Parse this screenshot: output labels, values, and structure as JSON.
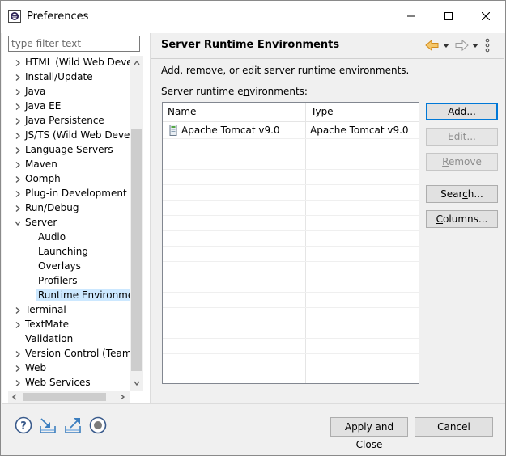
{
  "window": {
    "title": "Preferences"
  },
  "filter": {
    "placeholder": "type filter text"
  },
  "tree": {
    "items": [
      {
        "label": "HTML (Wild Web Develc",
        "expandable": true,
        "level": 0
      },
      {
        "label": "Install/Update",
        "expandable": true,
        "level": 0
      },
      {
        "label": "Java",
        "expandable": true,
        "level": 0
      },
      {
        "label": "Java EE",
        "expandable": true,
        "level": 0
      },
      {
        "label": "Java Persistence",
        "expandable": true,
        "level": 0
      },
      {
        "label": "JS/TS (Wild Web Develc",
        "expandable": true,
        "level": 0
      },
      {
        "label": "Language Servers",
        "expandable": true,
        "level": 0
      },
      {
        "label": "Maven",
        "expandable": true,
        "level": 0
      },
      {
        "label": "Oomph",
        "expandable": true,
        "level": 0
      },
      {
        "label": "Plug-in Development",
        "expandable": true,
        "level": 0
      },
      {
        "label": "Run/Debug",
        "expandable": true,
        "level": 0
      },
      {
        "label": "Server",
        "expandable": true,
        "expanded": true,
        "level": 0
      },
      {
        "label": "Audio",
        "expandable": false,
        "level": 1
      },
      {
        "label": "Launching",
        "expandable": false,
        "level": 1
      },
      {
        "label": "Overlays",
        "expandable": false,
        "level": 1
      },
      {
        "label": "Profilers",
        "expandable": false,
        "level": 1
      },
      {
        "label": "Runtime Environmen",
        "expandable": false,
        "level": 1,
        "selected": true
      },
      {
        "label": "Terminal",
        "expandable": true,
        "level": 0
      },
      {
        "label": "TextMate",
        "expandable": true,
        "level": 0
      },
      {
        "label": "Validation",
        "expandable": false,
        "level": 0
      },
      {
        "label": "Version Control (Team)",
        "expandable": true,
        "level": 0
      },
      {
        "label": "Web",
        "expandable": true,
        "level": 0
      },
      {
        "label": "Web Services",
        "expandable": true,
        "level": 0
      }
    ]
  },
  "page": {
    "title": "Server Runtime Environments",
    "description": "Add, remove, or edit server runtime environments.",
    "list_label_pre": "Server runtime e",
    "list_label_mnemonic": "n",
    "list_label_post": "vironments:"
  },
  "table": {
    "columns": [
      "Name",
      "Type"
    ],
    "rows": [
      {
        "name": "Apache Tomcat v9.0",
        "type": "Apache Tomcat v9.0"
      }
    ]
  },
  "buttons": {
    "add_mnemonic": "A",
    "add_rest": "dd...",
    "edit_mnemonic": "E",
    "edit_rest": "dit...",
    "remove_mnemonic": "R",
    "remove_rest": "emove",
    "search_pre": "Sear",
    "search_mnemonic": "c",
    "search_post": "h...",
    "columns_mnemonic": "C",
    "columns_rest": "olumns..."
  },
  "footer": {
    "apply_close": "Apply and Close",
    "cancel": "Cancel"
  },
  "colors": {
    "accent": "#0078d7",
    "selection": "#cce8ff",
    "nav_arrow": "#e8a33d"
  }
}
